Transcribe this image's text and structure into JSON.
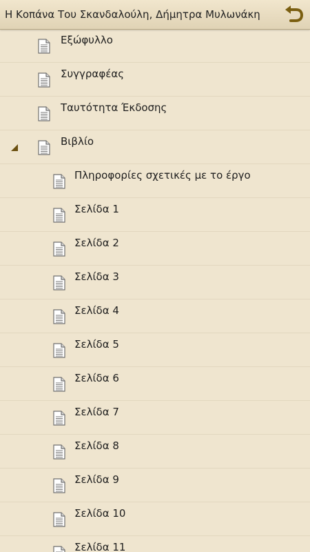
{
  "header": {
    "title": "Η Κοπάνα Του Σκανδαλούλη, Δήμητρα Μυλωνάκη",
    "back_icon": "back-arrow-icon"
  },
  "toc": [
    {
      "label": "Εξώφυλλο",
      "level": 0,
      "expanded": false
    },
    {
      "label": "Συγγραφέας",
      "level": 0,
      "expanded": false
    },
    {
      "label": "Ταυτότητα Έκδοσης",
      "level": 0,
      "expanded": false
    },
    {
      "label": "Βιβλίο",
      "level": 0,
      "expanded": true
    },
    {
      "label": "Πληροφορίες σχετικές με το έργο",
      "level": 1
    },
    {
      "label": "Σελίδα 1",
      "level": 1
    },
    {
      "label": "Σελίδα 2",
      "level": 1
    },
    {
      "label": "Σελίδα 3",
      "level": 1
    },
    {
      "label": "Σελίδα 4",
      "level": 1
    },
    {
      "label": "Σελίδα 5",
      "level": 1
    },
    {
      "label": "Σελίδα 6",
      "level": 1
    },
    {
      "label": "Σελίδα 7",
      "level": 1
    },
    {
      "label": "Σελίδα 8",
      "level": 1
    },
    {
      "label": "Σελίδα 9",
      "level": 1
    },
    {
      "label": "Σελίδα 10",
      "level": 1
    },
    {
      "label": "Σελίδα 11",
      "level": 1
    }
  ],
  "colors": {
    "background": "#efe5cf",
    "accent": "#7a5e10"
  }
}
